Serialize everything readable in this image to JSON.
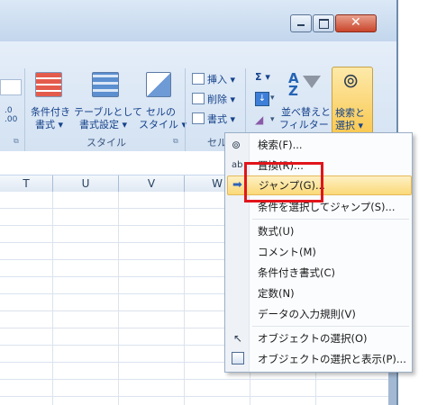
{
  "ribbon": {
    "style_group": {
      "label": "スタイル",
      "conditional_format": [
        "条件付き",
        "書式 ▾"
      ],
      "format_as_table": [
        "テーブルとして",
        "書式設定 ▾"
      ],
      "cell_styles": [
        "セルの",
        "スタイル ▾"
      ]
    },
    "cells_group": {
      "label": "セル",
      "insert": "挿入 ▾",
      "delete": "削除 ▾",
      "format": "書式 ▾"
    },
    "editing_group": {
      "sigma": "Σ ▾",
      "sort_filter": [
        "並べ替えと",
        "フィルター ▾"
      ],
      "find_select": [
        "検索と",
        "選択 ▾"
      ]
    },
    "number_dec": [
      ".0",
      ".00"
    ]
  },
  "columns": [
    "T",
    "U",
    "V",
    "W"
  ],
  "menu": {
    "items": [
      {
        "label": "検索(F)...",
        "icon": "binoculars-icon"
      },
      {
        "label": "置換(R)...",
        "icon": "replace-icon"
      },
      {
        "label": "ジャンプ(G)...",
        "icon": "arrow-right-icon",
        "highlighted": true
      },
      {
        "label": "条件を選択してジャンプ(S)...",
        "icon": ""
      },
      {
        "label": "数式(U)",
        "icon": ""
      },
      {
        "label": "コメント(M)",
        "icon": ""
      },
      {
        "label": "条件付き書式(C)",
        "icon": ""
      },
      {
        "label": "定数(N)",
        "icon": ""
      },
      {
        "label": "データの入力規則(V)",
        "icon": ""
      },
      {
        "label": "オブジェクトの選択(O)",
        "icon": "pointer-icon"
      },
      {
        "label": "オブジェクトの選択と表示(P)...",
        "icon": "selection-pane-icon"
      }
    ]
  },
  "colors": {
    "highlight": "#fbd978",
    "redbox": "#e1151b"
  }
}
